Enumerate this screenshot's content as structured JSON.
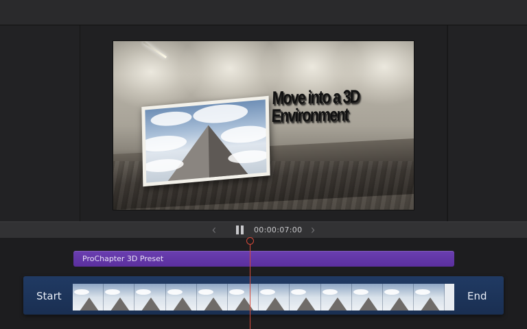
{
  "transport": {
    "timecode": "00:00:07:00",
    "prev_icon": "‹",
    "next_icon": "›"
  },
  "preview": {
    "title_line1": "Move into a 3D",
    "title_line2": "Environment"
  },
  "timeline": {
    "preset_track_label": "ProChapter 3D Preset",
    "clip_start_label": "Start",
    "clip_end_label": "End",
    "filmstrip_frames": 12
  },
  "colors": {
    "preset_track": "#5b2f9e",
    "clip_track": "#1a2f52",
    "playhead": "#d64a3a"
  }
}
